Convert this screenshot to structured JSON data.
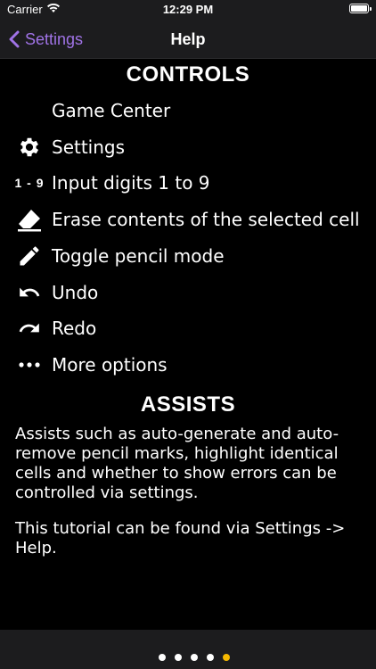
{
  "status_bar": {
    "carrier": "Carrier",
    "time": "12:29 PM"
  },
  "nav": {
    "back_label": "Settings",
    "title": "Help"
  },
  "controls": {
    "title": "CONTROLS",
    "items": [
      {
        "icon": "game-center-icon",
        "label": "Game Center"
      },
      {
        "icon": "gear-icon",
        "label": "Settings"
      },
      {
        "icon": "digits-icon",
        "icon_text": "1 - 9",
        "label": "Input digits 1 to 9"
      },
      {
        "icon": "eraser-icon",
        "label": "Erase contents of the selected cell"
      },
      {
        "icon": "pencil-icon",
        "label": "Toggle pencil mode"
      },
      {
        "icon": "undo-icon",
        "label": "Undo"
      },
      {
        "icon": "redo-icon",
        "label": "Redo"
      },
      {
        "icon": "more-options-icon",
        "label": "More options"
      }
    ]
  },
  "assists": {
    "title": "ASSISTS",
    "paragraph1": "Assists such as auto-generate and auto-remove pencil marks, highlight identical cells and whether to show errors can be controlled via settings.",
    "paragraph2": "This tutorial can be found via Settings -> Help."
  },
  "pager": {
    "pages": 5,
    "current_page": 5,
    "active_color": "#f5b800"
  },
  "colors": {
    "accent": "#a073e6",
    "background": "#000000",
    "bar": "#1c1c1e"
  }
}
